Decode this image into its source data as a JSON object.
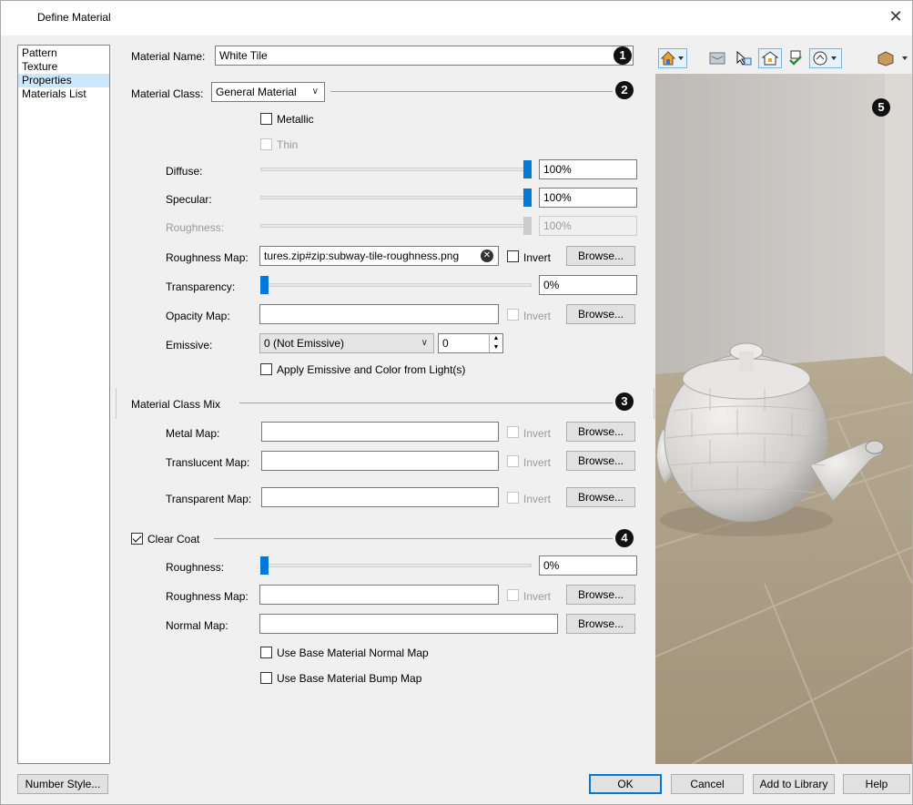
{
  "window": {
    "title": "Define Material",
    "close_glyph": "✕"
  },
  "nav": {
    "items": [
      {
        "label": "Pattern"
      },
      {
        "label": "Texture"
      },
      {
        "label": "Properties"
      },
      {
        "label": "Materials List"
      }
    ],
    "selected": "Properties"
  },
  "material_name": {
    "label": "Material Name:",
    "value": "White Tile"
  },
  "material_class": {
    "label": "Material Class:",
    "value": "General Material"
  },
  "metallic": {
    "label": "Metallic",
    "checked": false
  },
  "thin": {
    "label": "Thin",
    "checked": false,
    "enabled": false
  },
  "diffuse": {
    "label": "Diffuse:",
    "value": "100%",
    "fraction": 1.0
  },
  "specular": {
    "label": "Specular:",
    "value": "100%",
    "fraction": 1.0
  },
  "roughness": {
    "label": "Roughness:",
    "value": "100%",
    "fraction": 1.0,
    "enabled": false
  },
  "roughness_map": {
    "label": "Roughness Map:",
    "value": "tures.zip#zip:subway-tile-roughness.png",
    "invert_label": "Invert",
    "browse_label": "Browse..."
  },
  "transparency": {
    "label": "Transparency:",
    "value": "0%",
    "fraction": 0.0
  },
  "opacity_map": {
    "label": "Opacity Map:",
    "value": "",
    "invert_label": "Invert",
    "browse_label": "Browse..."
  },
  "emissive": {
    "label": "Emissive:",
    "value": "0 (Not Emissive)",
    "spin_value": "0"
  },
  "apply_emissive": {
    "label": "Apply Emissive and Color from Light(s)",
    "checked": false
  },
  "class_mix": {
    "heading": "Material Class Mix",
    "metal_map": {
      "label": "Metal Map:",
      "value": "",
      "invert_label": "Invert",
      "browse_label": "Browse..."
    },
    "translucent_map": {
      "label": "Translucent Map:",
      "value": "",
      "invert_label": "Invert",
      "browse_label": "Browse..."
    },
    "transparent_map": {
      "label": "Transparent Map:",
      "value": "",
      "invert_label": "Invert",
      "browse_label": "Browse..."
    }
  },
  "clear_coat": {
    "label": "Clear Coat",
    "checked": true,
    "roughness": {
      "label": "Roughness:",
      "value": "0%",
      "fraction": 0.0
    },
    "roughness_map": {
      "label": "Roughness Map:",
      "value": "",
      "invert_label": "Invert",
      "browse_label": "Browse..."
    },
    "normal_map": {
      "label": "Normal Map:",
      "value": "",
      "browse_label": "Browse..."
    },
    "use_normal": {
      "label": "Use Base Material Normal Map",
      "checked": false
    },
    "use_bump": {
      "label": "Use Base Material Bump Map",
      "checked": false
    }
  },
  "callouts": [
    "1",
    "2",
    "3",
    "4",
    "5"
  ],
  "toolbar_icons": [
    "house-view-icon",
    "layers-icon",
    "select-objects-icon",
    "camera-icon",
    "check-icon",
    "shape-icon",
    "material-icon"
  ],
  "footer": {
    "number_style": "Number Style...",
    "ok": "OK",
    "cancel": "Cancel",
    "add_to_library": "Add to Library",
    "help": "Help"
  },
  "colors": {
    "accent": "#0078d7",
    "selection": "#cce8ff",
    "dialog_bg": "#f0f0f0"
  }
}
